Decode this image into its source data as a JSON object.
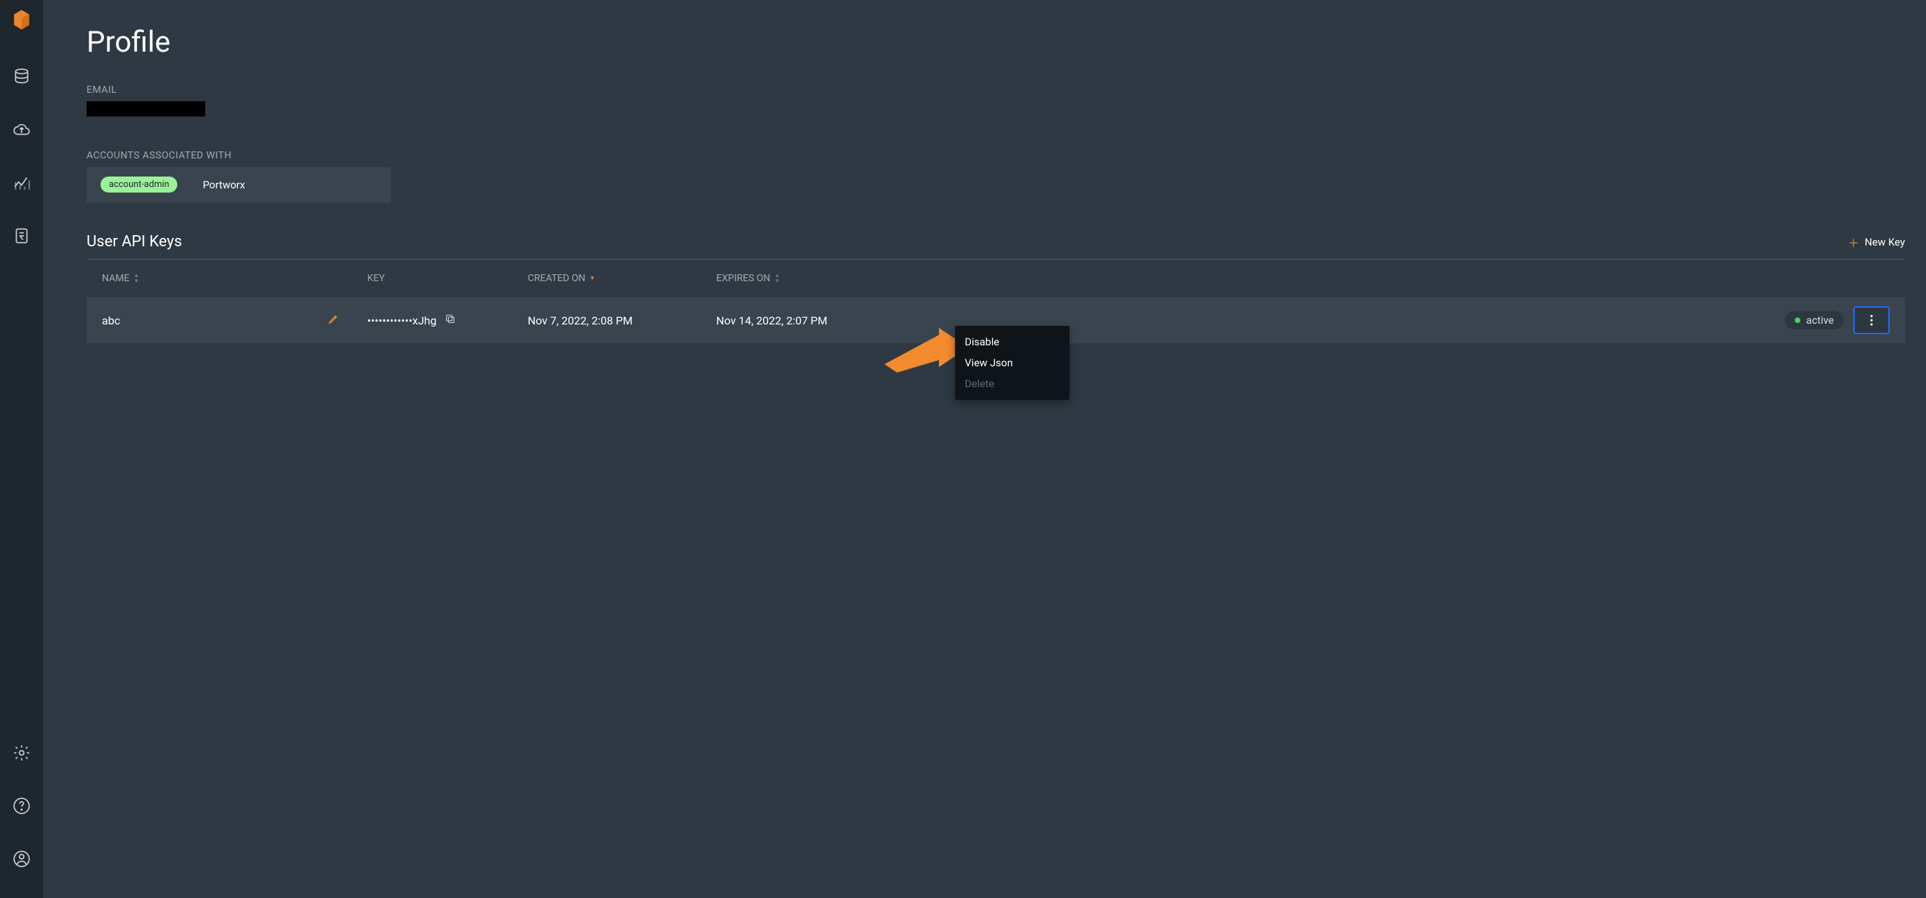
{
  "page_title": "Profile",
  "email_label": "EMAIL",
  "accounts_label": "ACCOUNTS ASSOCIATED WITH",
  "account_badge": "account-admin",
  "account_name": "Portworx",
  "keys_section_title": "User API Keys",
  "new_key_label": "New Key",
  "columns": {
    "name": "NAME",
    "key": "KEY",
    "created": "CREATED ON",
    "expires": "EXPIRES ON"
  },
  "row": {
    "name": "abc",
    "key": "••••••••••••xJhg",
    "created": "Nov 7, 2022, 2:08 PM",
    "expires": "Nov 14, 2022, 2:07 PM",
    "status": "active"
  },
  "menu": {
    "disable": "Disable",
    "view_json": "View Json",
    "delete": "Delete"
  }
}
